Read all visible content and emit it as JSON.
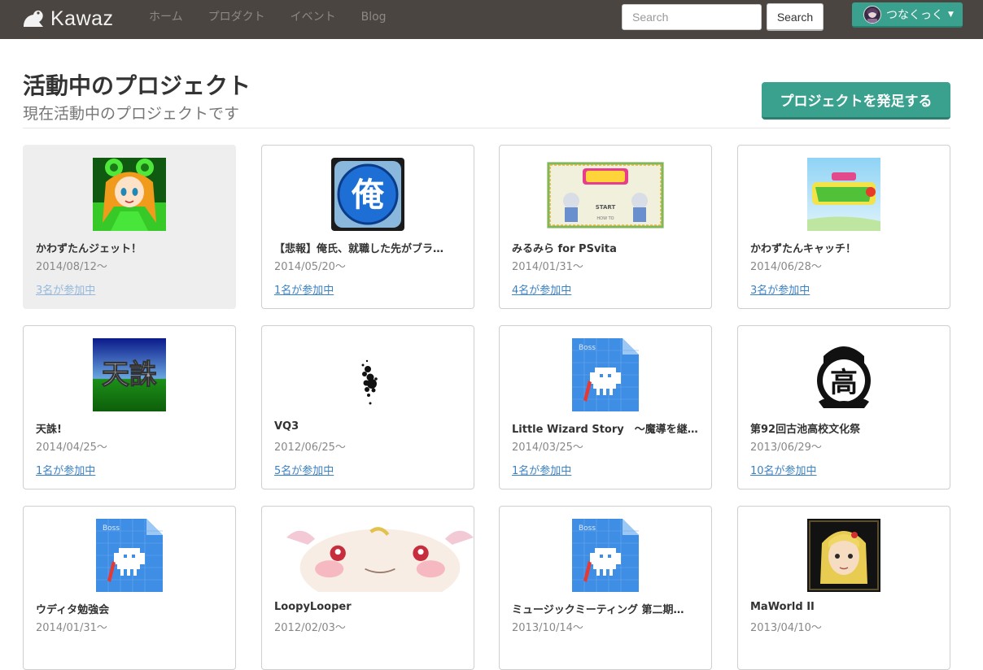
{
  "navbar": {
    "brand": "Kawaz",
    "links": [
      "ホーム",
      "プロダクト",
      "イベント",
      "Blog"
    ],
    "search_placeholder": "Search",
    "search_button": "Search",
    "user_name": "つなくっく"
  },
  "header": {
    "title": "活動中のプロジェクト",
    "subtitle": "現在活動中のプロジェクトです",
    "create_button": "プロジェクトを発足する"
  },
  "projects": [
    {
      "title": "かわずたんジェット！",
      "date": "2014/08/12〜",
      "members": "3名が参加中",
      "thumb": "girl-frog"
    },
    {
      "title": "【悲報】俺氏、就職した先がブラ…",
      "date": "2014/05/20〜",
      "members": "1名が参加中",
      "thumb": "ore"
    },
    {
      "title": "みるみら for PSvita",
      "date": "2014/01/31〜",
      "members": "4名が参加中",
      "thumb": "mirumira"
    },
    {
      "title": "かわずたんキャッチ！",
      "date": "2014/06/28〜",
      "members": "3名が参加中",
      "thumb": "catch"
    },
    {
      "title": "天誅!",
      "date": "2014/04/25〜",
      "members": "1名が参加中",
      "thumb": "tenchu"
    },
    {
      "title": "VQ3",
      "date": "2012/06/25〜",
      "members": "5名が参加中",
      "thumb": "vq3"
    },
    {
      "title": "Little Wizard Story　〜魔導を継…",
      "date": "2014/03/25〜",
      "members": "1名が参加中",
      "thumb": "boss"
    },
    {
      "title": "第92回古池高校文化祭",
      "date": "2013/06/29〜",
      "members": "10名が参加中",
      "thumb": "crest"
    },
    {
      "title": "ウディタ勉強会",
      "date": "2014/01/31〜",
      "members": "",
      "thumb": "boss"
    },
    {
      "title": "LoopyLooper",
      "date": "2012/02/03〜",
      "members": "",
      "thumb": "axolotl"
    },
    {
      "title": "ミュージックミーティング 第二期…",
      "date": "2013/10/14〜",
      "members": "",
      "thumb": "boss"
    },
    {
      "title": "MaWorld II",
      "date": "2013/04/10〜",
      "members": "",
      "thumb": "blonde"
    }
  ]
}
